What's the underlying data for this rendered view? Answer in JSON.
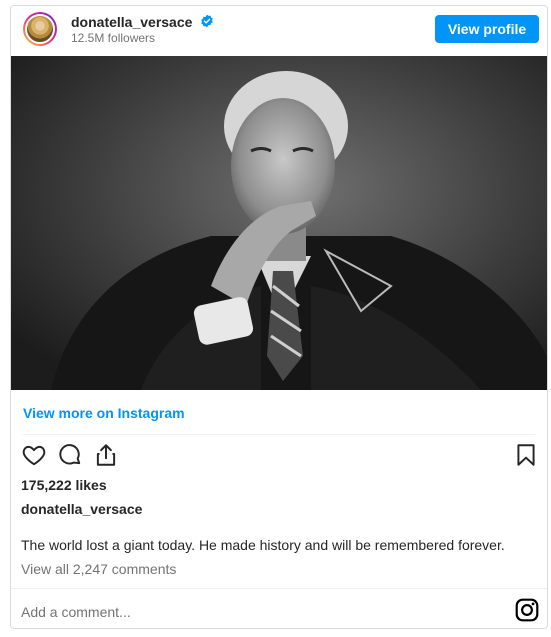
{
  "header": {
    "username": "donatella_versace",
    "followers": "12.5M followers",
    "view_profile_label": "View profile"
  },
  "post": {
    "view_more_label": "View more on Instagram",
    "likes": "175,222 likes",
    "caption_user": "donatella_versace",
    "caption": "The world lost a giant today. He made history and will be remembered forever.",
    "comments_link": "View all 2,247 comments",
    "add_comment_placeholder": "Add a comment..."
  },
  "icons": {
    "verified": "verified-badge-icon",
    "like": "heart-icon",
    "comment": "comment-bubble-icon",
    "share": "share-icon",
    "save": "bookmark-icon",
    "brand": "instagram-icon"
  },
  "colors": {
    "accent": "#0095f6",
    "text": "#262626",
    "muted": "#737373",
    "border": "#dbdbdb"
  }
}
